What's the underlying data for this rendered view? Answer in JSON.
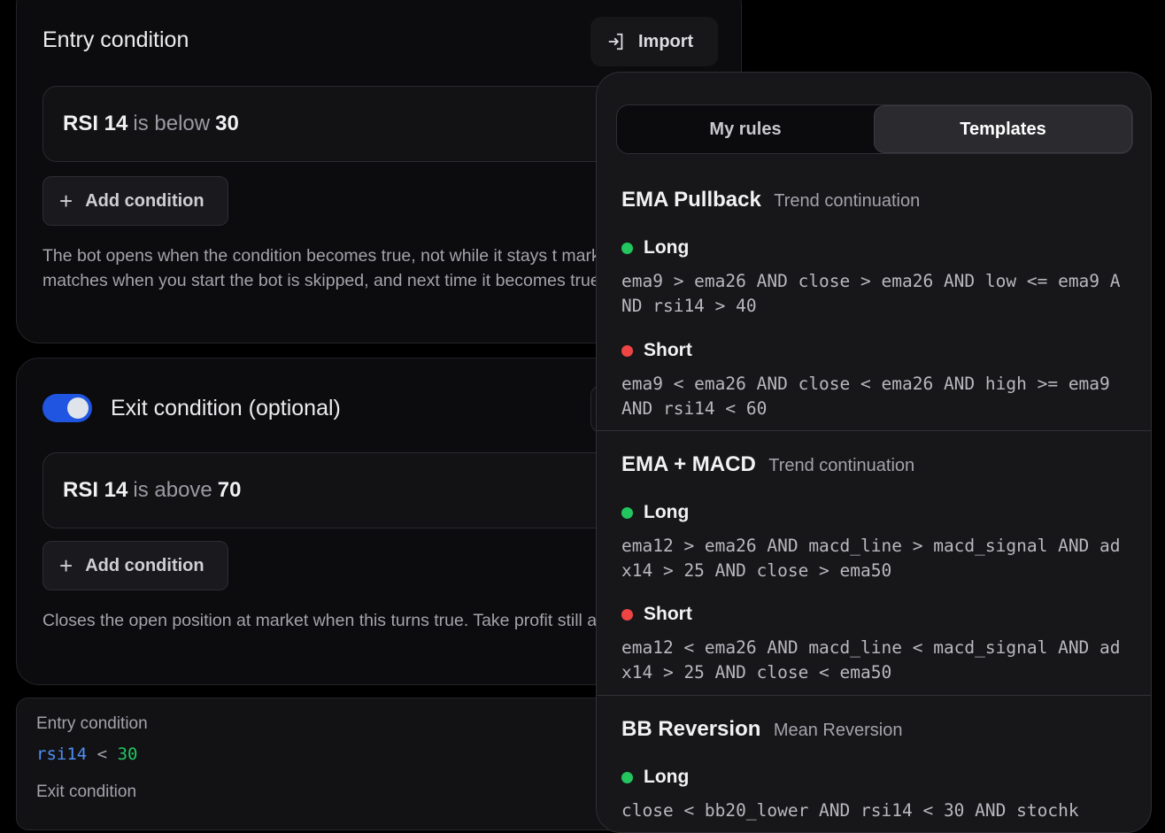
{
  "entry": {
    "title": "Entry condition",
    "import_label": "Import",
    "rule": {
      "indicator": "RSI 14",
      "operator": "is below",
      "value": "30"
    },
    "add_label": "Add condition",
    "help": "The bot opens when the condition becomes true, not while it stays t market that already matches when you start the bot is skipped, and next time it becomes true."
  },
  "exit": {
    "title": "Exit condition (optional)",
    "enabled": true,
    "rule": {
      "indicator": "RSI 14",
      "operator": "is above",
      "value": "70"
    },
    "add_label": "Add condition",
    "help": "Closes the open position at market when this turns true. Take profit still apply."
  },
  "summary": {
    "entry_label": "Entry condition",
    "entry_code": {
      "var": "rsi14",
      "op": "<",
      "num": "30"
    },
    "exit_label": "Exit condition"
  },
  "panel": {
    "tabs": [
      "My rules",
      "Templates"
    ],
    "active_tab": "Templates",
    "templates": [
      {
        "name": "EMA Pullback",
        "category": "Trend continuation",
        "long_label": "Long",
        "long": "ema9 > ema26 AND close > ema26 AND low <= ema9 AND rsi14 > 40",
        "short_label": "Short",
        "short": "ema9 < ema26 AND close < ema26 AND high >= ema9 AND rsi14 < 60"
      },
      {
        "name": "EMA + MACD",
        "category": "Trend continuation",
        "long_label": "Long",
        "long": "ema12 > ema26 AND macd_line > macd_signal AND adx14 > 25 AND close > ema50",
        "short_label": "Short",
        "short": "ema12 < ema26 AND macd_line < macd_signal AND adx14 > 25 AND close < ema50"
      },
      {
        "name": "BB Reversion",
        "category": "Mean Reversion",
        "long_label": "Long",
        "long": "close < bb20_lower AND rsi14 < 30 AND stochk"
      }
    ]
  },
  "colors": {
    "accent": "#1f55e0",
    "long": "#22c55e",
    "short": "#ef4444",
    "code_var": "#4f8ff7",
    "code_num": "#22c55e"
  }
}
